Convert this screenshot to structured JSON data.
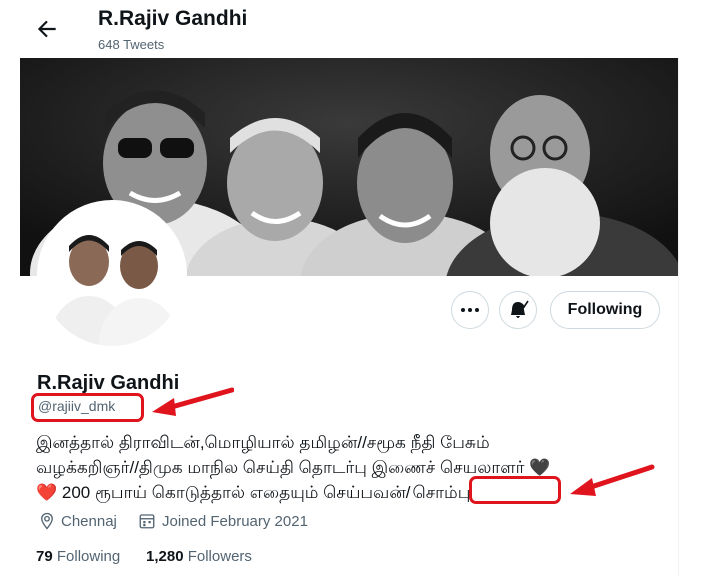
{
  "header": {
    "title": "R.Rajiv Gandhi",
    "tweet_count": "648 Tweets"
  },
  "icons": {
    "back": "back-arrow-icon",
    "more": "more-icon",
    "notify": "bell-notification-icon",
    "location": "location-pin-icon",
    "calendar": "calendar-icon"
  },
  "actions": {
    "follow_label": "Following"
  },
  "profile": {
    "name": "R.Rajiv Gandhi",
    "handle": "@rajiiv_dmk",
    "bio_line1": "இனத்தால் திராவிடன்,மொழியால் தமிழன்//சமூக நீதி பேசும்",
    "bio_line2": "வழக்கறிஞர்//திமுக மாநில செய்தி தொடர்பு இணைச் செயலாளர் 🖤",
    "bio_line3_pre": "❤️ 200 ரூபாய் கொடுத்தால் எதையும் செய்பவன்/",
    "bio_line3_highlight": "சொம்பு",
    "location": "Chennaj",
    "joined": "Joined February 2021",
    "following_count": "79",
    "following_label": "Following",
    "followers_count": "1,280",
    "followers_label": "Followers"
  },
  "colors": {
    "annotation_red": "#e0141d",
    "muted_text": "#536471",
    "text": "#0f1419",
    "border": "#cfd9de"
  }
}
